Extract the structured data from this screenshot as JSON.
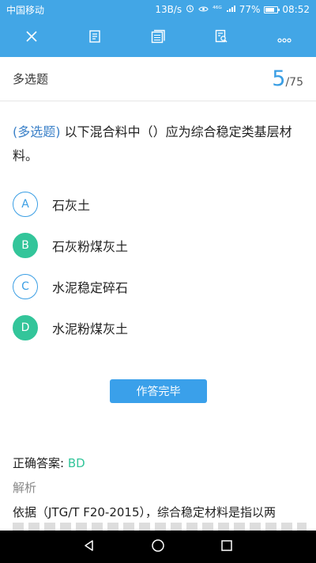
{
  "status_bar": {
    "carrier": "中国移动",
    "speed": "13B/s",
    "signal": "⁴⁶ᴳ",
    "battery": "77%",
    "time": "08:52"
  },
  "toolbar": {
    "icons": [
      "close-icon",
      "edit-icon",
      "card-icon",
      "search-doc-icon",
      "more-icon"
    ]
  },
  "question_header": {
    "type_label": "多选题",
    "current": "5",
    "total": "/75"
  },
  "question": {
    "tag": "(多选题)",
    "text": " 以下混合料中（）应为综合稳定类基层材料。"
  },
  "options": [
    {
      "letter": "A",
      "text": "石灰土",
      "selected": false
    },
    {
      "letter": "B",
      "text": "石灰粉煤灰土",
      "selected": true
    },
    {
      "letter": "C",
      "text": "水泥稳定碎石",
      "selected": false
    },
    {
      "letter": "D",
      "text": "水泥粉煤灰土",
      "selected": true
    }
  ],
  "submit_label": "作答完毕",
  "answer": {
    "label": "正确答案: ",
    "value": "BD"
  },
  "analysis": {
    "label": "解析",
    "text": "依据（JTG/T F20-2015），综合稳定材料是指以两"
  },
  "colors": {
    "primary": "#42a6e6",
    "selected": "#33c59a"
  }
}
